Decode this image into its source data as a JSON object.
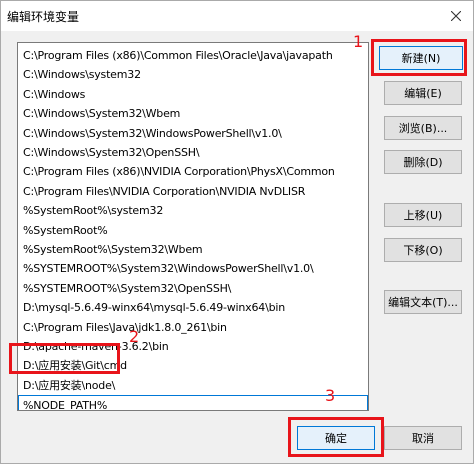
{
  "window": {
    "title": "编辑环境变量"
  },
  "env_paths": [
    "C:\\Program Files (x86)\\Common Files\\Oracle\\Java\\javapath",
    "C:\\Windows\\system32",
    "C:\\Windows",
    "C:\\Windows\\System32\\Wbem",
    "C:\\Windows\\System32\\WindowsPowerShell\\v1.0\\",
    "C:\\Windows\\System32\\OpenSSH\\",
    "C:\\Program Files (x86)\\NVIDIA Corporation\\PhysX\\Common",
    "C:\\Program Files\\NVIDIA Corporation\\NVIDIA NvDLISR",
    "%SystemRoot%\\system32",
    "%SystemRoot%",
    "%SystemRoot%\\System32\\Wbem",
    "%SYSTEMROOT%\\System32\\WindowsPowerShell\\v1.0\\",
    "%SYSTEMROOT%\\System32\\OpenSSH\\",
    "D:\\mysql-5.6.49-winx64\\mysql-5.6.49-winx64\\bin",
    "C:\\Program Files\\Java\\jdk1.8.0_261\\bin",
    "D:\\apache-maven-3.6.2\\bin",
    "D:\\应用安装\\Git\\cmd",
    "D:\\应用安装\\node\\",
    "%NODE_PATH%"
  ],
  "buttons": {
    "new": "新建(N)",
    "edit": "编辑(E)",
    "browse": "浏览(B)...",
    "delete": "删除(D)",
    "move_up": "上移(U)",
    "move_down": "下移(O)",
    "edit_text": "编辑文本(T)...",
    "ok": "确定",
    "cancel": "取消"
  },
  "annotations": {
    "marker_1": "1",
    "marker_2": "2",
    "marker_3": "3",
    "color": "#e8141a"
  },
  "icons": {
    "close": "close-icon"
  }
}
